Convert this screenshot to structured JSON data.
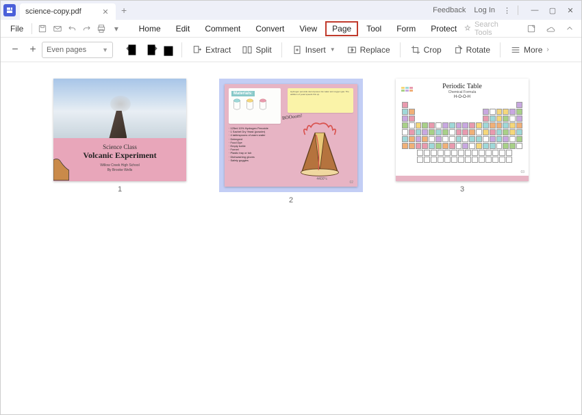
{
  "titlebar": {
    "filename": "science-copy.pdf",
    "feedback": "Feedback",
    "login": "Log In"
  },
  "menu": {
    "file": "File",
    "items": [
      "Home",
      "Edit",
      "Comment",
      "Convert",
      "View",
      "Page",
      "Tool",
      "Form",
      "Protect"
    ],
    "active_index": 5,
    "search_placeholder": "Search Tools"
  },
  "toolbar": {
    "pages_filter": "Even pages",
    "extract": "Extract",
    "split": "Split",
    "insert": "Insert",
    "replace": "Replace",
    "crop": "Crop",
    "rotate": "Rotate",
    "more": "More"
  },
  "thumbnails": [
    {
      "num": "1",
      "selected": false,
      "page1": {
        "heading_small": "Science Class",
        "heading_big": "Volcanic Experiment",
        "school": "Willow Creek High School",
        "author": "By Brooke Wells"
      }
    },
    {
      "num": "2",
      "selected": true,
      "page2": {
        "materials_label": "Materials:",
        "boom": "BOOoom!",
        "temp": "4400°c",
        "list": "· 125ml 10% Hydrogen Peroxide\n· 1 Sachet Dry Yeast (powder)\n· 4 tablespoons of warm water\n· Detergent\n· Food Dye\n· Empty bottle\n· Funnel\n· Plastic tray or tub\n· Dishwashing gloves\n· Safety goggles",
        "page_no": "02"
      }
    },
    {
      "num": "3",
      "selected": false,
      "page3": {
        "title": "Periodic Table",
        "subtitle": "Chemical Formula",
        "formula": "H-O-O-H",
        "page_no": "03"
      }
    }
  ]
}
